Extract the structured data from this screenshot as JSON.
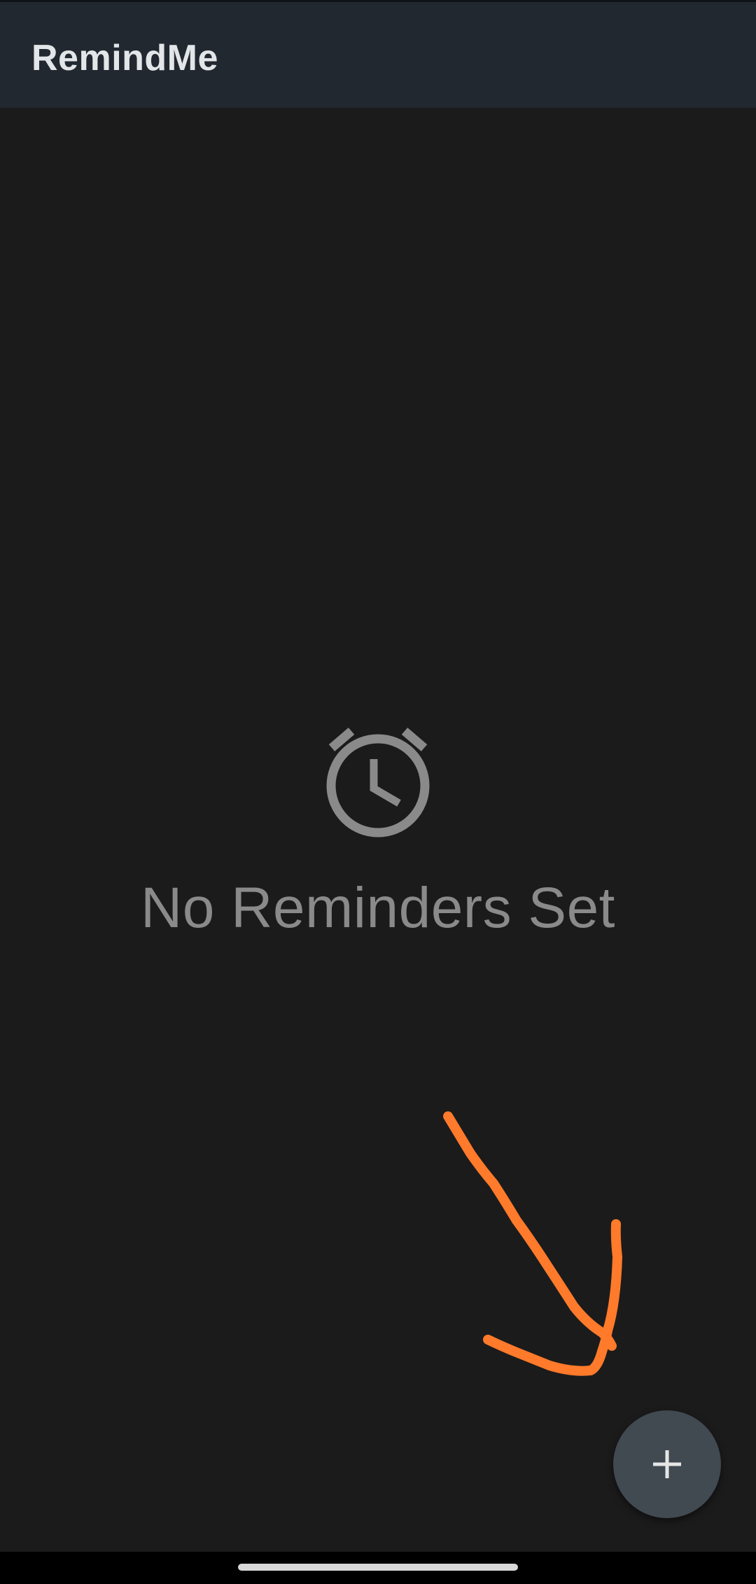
{
  "app_bar": {
    "title": "RemindMe"
  },
  "empty_state": {
    "icon": "alarm-clock-icon",
    "message": "No Reminders Set"
  },
  "fab": {
    "icon": "plus-icon"
  },
  "annotation": {
    "icon": "arrow-annotation",
    "color": "#ff7a2b"
  },
  "colors": {
    "background": "#1b1b1b",
    "app_bar": "#212830",
    "fab": "#414951",
    "muted_text": "#8a8a8a"
  }
}
